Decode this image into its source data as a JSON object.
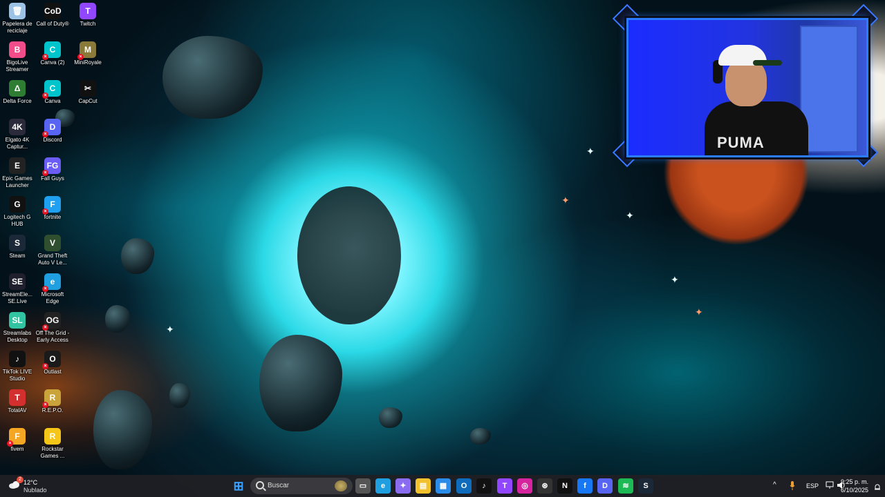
{
  "desktop": {
    "icons": [
      {
        "label": "Papelera de reciclaje",
        "icon": "recycle-bin-icon",
        "color": "#9cc2e6",
        "glyph": "🗑",
        "x": false
      },
      {
        "label": "BigoLive Streamer",
        "icon": "bigolive-icon",
        "color": "#f04d8a",
        "glyph": "B",
        "x": false
      },
      {
        "label": "Delta Force",
        "icon": "delta-force-icon",
        "color": "#2e7d32",
        "glyph": "Δ",
        "x": false
      },
      {
        "label": "Elgato 4K Captur...",
        "icon": "elgato-icon",
        "color": "#2a2a3a",
        "glyph": "4K",
        "x": false
      },
      {
        "label": "Epic Games Launcher",
        "icon": "epic-games-icon",
        "color": "#222",
        "glyph": "E",
        "x": false
      },
      {
        "label": "Logitech G HUB",
        "icon": "logitech-icon",
        "color": "#111",
        "glyph": "G",
        "x": false
      },
      {
        "label": "Steam",
        "icon": "steam-icon",
        "color": "#1b2838",
        "glyph": "S",
        "x": false
      },
      {
        "label": "StreamEle... SE.Live",
        "icon": "streamelements-icon",
        "color": "#1f1f2e",
        "glyph": "SE",
        "x": false
      },
      {
        "label": "Streamlabs Desktop",
        "icon": "streamlabs-icon",
        "color": "#31c3a2",
        "glyph": "SL",
        "x": false
      },
      {
        "label": "TikTok LIVE Studio",
        "icon": "tiktok-live-icon",
        "color": "#111",
        "glyph": "♪",
        "x": false
      },
      {
        "label": "TotalAV",
        "icon": "totalav-icon",
        "color": "#d32f2f",
        "glyph": "T",
        "x": false
      },
      {
        "label": "fivem",
        "icon": "fivem-icon",
        "color": "#f5a623",
        "glyph": "F",
        "x": true
      },
      {
        "label": "Call of Duty®",
        "icon": "call-of-duty-icon",
        "color": "#111",
        "glyph": "CoD",
        "x": false
      },
      {
        "label": "Canva (2)",
        "icon": "canva-icon",
        "color": "#00c4cc",
        "glyph": "C",
        "x": true
      },
      {
        "label": "Canva",
        "icon": "canva-icon",
        "color": "#00c4cc",
        "glyph": "C",
        "x": true
      },
      {
        "label": "Discord",
        "icon": "discord-icon",
        "color": "#5865f2",
        "glyph": "D",
        "x": true
      },
      {
        "label": "Fall Guys",
        "icon": "fall-guys-icon",
        "color": "#6b5cf5",
        "glyph": "FG",
        "x": true
      },
      {
        "label": "fortnite",
        "icon": "fortnite-icon",
        "color": "#1fa0f0",
        "glyph": "F",
        "x": true
      },
      {
        "label": "Grand Theft Auto V Le...",
        "icon": "gta-icon",
        "color": "#2f4f2f",
        "glyph": "V",
        "x": false
      },
      {
        "label": "Microsoft Edge",
        "icon": "edge-icon",
        "color": "#1f9ee0",
        "glyph": "e",
        "x": true
      },
      {
        "label": "Off The Grid - Early Access",
        "icon": "off-the-grid-icon",
        "color": "#222",
        "glyph": "OG",
        "x": true
      },
      {
        "label": "Outlast",
        "icon": "outlast-icon",
        "color": "#1a1a1a",
        "glyph": "O",
        "x": true
      },
      {
        "label": "R.E.P.O.",
        "icon": "repo-icon",
        "color": "#caa43a",
        "glyph": "R",
        "x": true
      },
      {
        "label": "Rockstar Games ...",
        "icon": "rockstar-icon",
        "color": "#f5c518",
        "glyph": "R",
        "x": false
      },
      {
        "label": "Twitch",
        "icon": "twitch-icon",
        "color": "#9146ff",
        "glyph": "T",
        "x": false
      },
      {
        "label": "MiniRoyale",
        "icon": "miniroyale-icon",
        "color": "#8a7a3a",
        "glyph": "M",
        "x": true
      },
      {
        "label": "CapCut",
        "icon": "capcut-icon",
        "color": "#111",
        "glyph": "✂",
        "x": false
      }
    ]
  },
  "webcam": {
    "shirt_text": "PUMA"
  },
  "taskbar": {
    "weather_temp": "12°C",
    "weather_desc": "Nublado",
    "weather_badge": "2",
    "search_placeholder": "Buscar",
    "apps": [
      {
        "name": "start",
        "icon": "windows-start-icon",
        "color": "#3aa0ff",
        "glyph": "⊞"
      },
      {
        "name": "task-view",
        "icon": "task-view-icon",
        "color": "#555",
        "glyph": "▭"
      },
      {
        "name": "edge",
        "icon": "edge-icon",
        "color": "#1f9ee0",
        "glyph": "e"
      },
      {
        "name": "copilot",
        "icon": "copilot-icon",
        "color": "#8a6cf0",
        "glyph": "✦"
      },
      {
        "name": "file-explorer",
        "icon": "folder-icon",
        "color": "#f2c12e",
        "glyph": "▤"
      },
      {
        "name": "store",
        "icon": "store-icon",
        "color": "#2b8be8",
        "glyph": "▦"
      },
      {
        "name": "outlook",
        "icon": "outlook-icon",
        "color": "#0f6cbd",
        "glyph": "O"
      },
      {
        "name": "tiktok",
        "icon": "tiktok-icon",
        "color": "#111",
        "glyph": "♪"
      },
      {
        "name": "twitch",
        "icon": "twitch-icon",
        "color": "#9146ff",
        "glyph": "T"
      },
      {
        "name": "instagram",
        "icon": "instagram-icon",
        "color": "#d6249f",
        "glyph": "◎"
      },
      {
        "name": "chatgpt",
        "icon": "chatgpt-icon",
        "color": "#333",
        "glyph": "⊛"
      },
      {
        "name": "netflix",
        "icon": "netflix-icon",
        "color": "#111",
        "glyph": "N"
      },
      {
        "name": "facebook",
        "icon": "facebook-icon",
        "color": "#1877f2",
        "glyph": "f"
      },
      {
        "name": "discord",
        "icon": "discord-icon",
        "color": "#5865f2",
        "glyph": "D"
      },
      {
        "name": "spotify",
        "icon": "spotify-icon",
        "color": "#1db954",
        "glyph": "≋"
      },
      {
        "name": "steam",
        "icon": "steam-icon",
        "color": "#1b2838",
        "glyph": "S"
      }
    ],
    "tray_chevron": "^",
    "language": "ESP",
    "time": "9:25 p. m.",
    "date": "6/10/2025"
  }
}
